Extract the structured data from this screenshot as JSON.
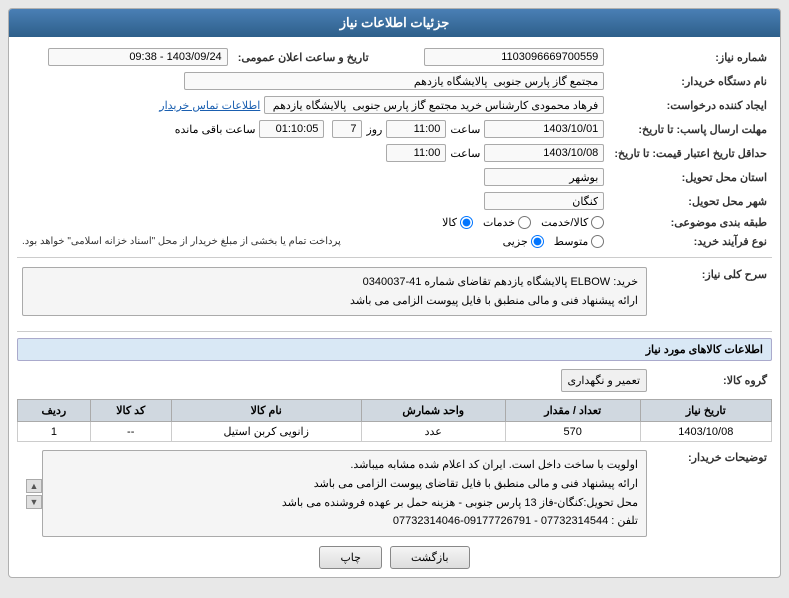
{
  "header": {
    "title": "جزئیات اطلاعات نیاز"
  },
  "fields": {
    "shomara_niaz_label": "شماره نیاز:",
    "shomara_niaz_value": "1103096669700559",
    "naam_dastgah_label": "نام دستگاه خریدار:",
    "naam_dastgah_value": "مجتمع گاز پارس جنوبی  پالایشگاه یازدهم",
    "ijad_label": "ایجاد کننده درخواست:",
    "ijad_value": "فرهاد محمودی کارشناس خرید مجتمع گاز پارس جنوبی  پالایشگاه یازدهم",
    "ijalat_tamas_label": "اطلاعات تماس خریدار",
    "mohlat_label": "مهلت ارسال پاسب: تا تاریخ:",
    "mohlat_date": "1403/10/01",
    "mohlat_time": "11:00",
    "mohlat_roz": "7",
    "mohlat_baqi": "01:10:05",
    "mohlat_baqi_label": "ساعت باقی مانده",
    "jadval_label": "حداقل تاریخ اعتبار قیمت: تا تاریخ:",
    "jadval_date": "1403/10/08",
    "jadval_time": "11:00",
    "tarikh_saet_label": "تاریخ و ساعت اعلان عمومی:",
    "tarikh_saet_value": "1403/09/24 - 09:38",
    "ostan_label": "استان محل تحویل:",
    "ostan_value": "بوشهر",
    "shahr_label": "شهر محل تحویل:",
    "shahr_value": "کنگان",
    "tabaqe_label": "طبقه بندی موضوعی:",
    "radio_kala": "کالا",
    "radio_khadamat": "خدمات",
    "radio_kala_khadamat": "کالا/خدمت",
    "nav_label": "نوع فرآیند خرید:",
    "nav_jazyi": "جزیی",
    "nav_motovaset": "متوسط",
    "pardakht_text": "پرداخت تمام یا بخشی از مبلغ خریدار از محل \"اسناد خزانه اسلامی\" خواهد بود.",
    "sarh_koli_label": "سرح کلی نیاز:",
    "sarh_koli_content": "خرید:  ELBOW  پالایشگاه یازدهم تقاضای شماره 41-0340037\nارائه پیشنهاد فنی و مالی منطبق با فایل پیوست الزامی می باشد",
    "ettelaat_section": "اطلاعات کالاهای مورد نیاز",
    "group_kala_label": "گروه کالا:",
    "group_kala_value": "تعمیر و نگهداری",
    "table_headers": {
      "radif": "ردیف",
      "code_kala": "کد کالا",
      "naam_kala": "نام کالا",
      "vahed": "واحد شمارش",
      "tedad": "تعداد / مقدار",
      "tarikh": "تاریخ نیاز"
    },
    "table_rows": [
      {
        "radif": "1",
        "code_kala": "--",
        "naam_kala": "زانویی کربن استیل",
        "vahed": "عدد",
        "tedad": "570",
        "tarikh": "1403/10/08"
      }
    ],
    "tozi_kharidar_label": "توضیحات خریدار:",
    "tozi_line1": "اولویت با ساخت داخل است. ایران کد اعلام شده مشابه میباشد.",
    "tozi_line2": "ارائه پیشنهاد فنی و مالی منطبق با فایل تقاضای پیوست الزامی می باشد",
    "tozi_line3": "محل تحویل:کنگان-فاز 13 پارس جنوبی - هزینه حمل بر عهده فروشنده می باشد",
    "tozi_line4": "تلفن : 07732314544 - 09177726791-07732314046",
    "btn_chap": "چاپ",
    "btn_bazgasht": "بازگشت"
  }
}
